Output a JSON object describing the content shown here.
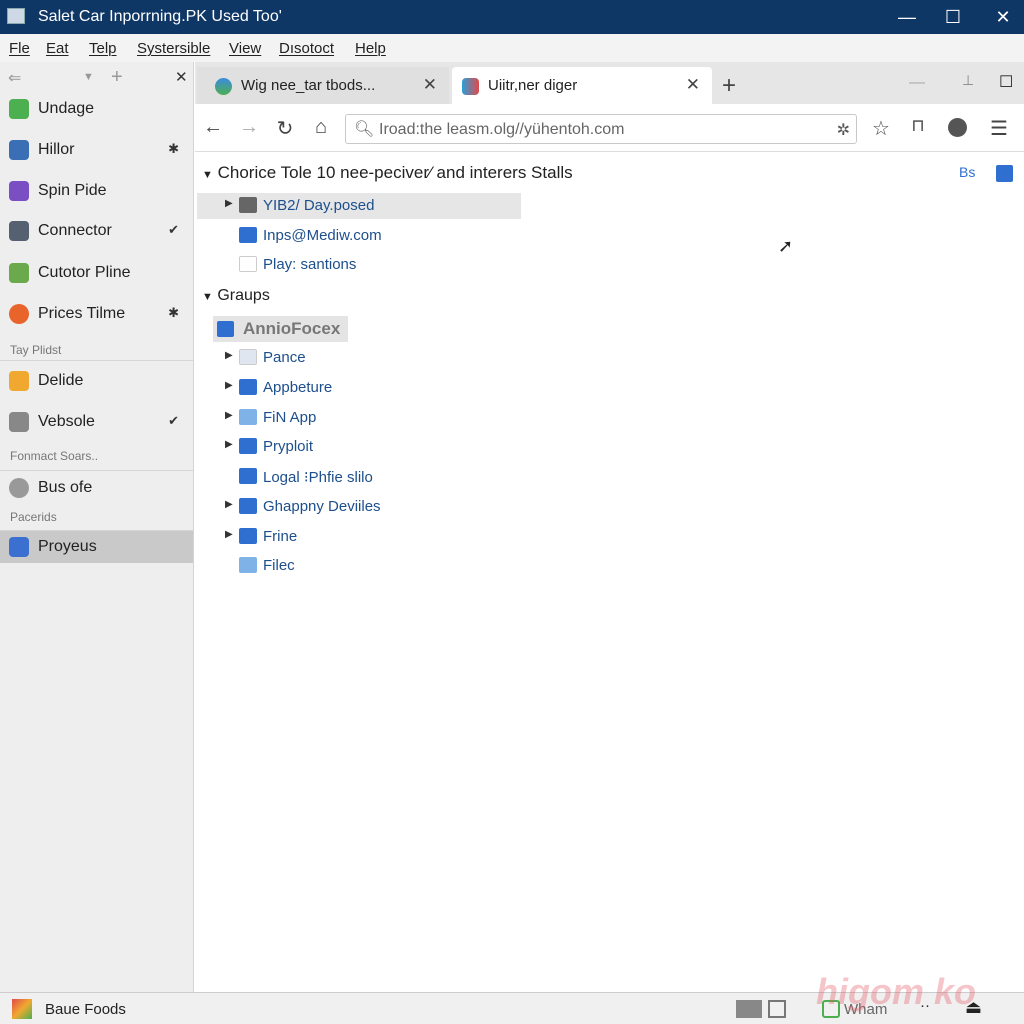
{
  "window": {
    "title": "Salet Car Inporrning.PK Used Too'",
    "controls": [
      "minimize",
      "maximize",
      "close"
    ]
  },
  "menu": [
    "Fle",
    "Eat",
    "Telp",
    "Systersible",
    "View",
    "Dısotoct",
    "Help"
  ],
  "sidebar": {
    "items": [
      {
        "label": "Undage",
        "icon": "app-icon",
        "color": "#4caf50"
      },
      {
        "label": "Hillor",
        "icon": "app-icon",
        "color": "#3a6fb5",
        "pin": "pin-icon"
      },
      {
        "label": "Spin Pide",
        "icon": "app-icon",
        "color": "#7b4fc4"
      },
      {
        "label": "Connector",
        "icon": "app-icon",
        "color": "#556070",
        "pin": "check-icon"
      },
      {
        "label": "Cutotor Pline",
        "icon": "app-icon",
        "color": "#6aaa4c"
      },
      {
        "label": "Prices Tilme",
        "icon": "firefox-icon",
        "color": "#e8642a",
        "pin": "pin-icon"
      },
      {
        "label": "Delide",
        "icon": "app-icon",
        "color": "#f0a830"
      },
      {
        "label": "Vebsole",
        "icon": "app-icon",
        "color": "#888888",
        "pin": "check-icon"
      },
      {
        "label": "Bus ofe",
        "icon": "gear-icon",
        "color": "#999999"
      },
      {
        "label": "Proyeus",
        "icon": "app-icon",
        "color": "#3b6fd0",
        "selected": true
      }
    ],
    "headers": [
      "Tay Plidst",
      "Fonmact Soars..",
      "Pacerids"
    ]
  },
  "tabs": [
    {
      "label": "Wig nee_tar tbods...",
      "active": false
    },
    {
      "label": "Uiitr,ner diger",
      "active": true
    }
  ],
  "address": {
    "url": "Iroad:the leasm.olg//yühentoh.com"
  },
  "content": {
    "section1": "Chorice Tole 10 nee-peciver⁄ and interers Stalls",
    "section1_items": [
      {
        "label": "YIB2/ Day.posed",
        "expand": true,
        "color": "#666666"
      },
      {
        "label": "Inps@Mediw.com",
        "expand": false,
        "color": "#2f6fd0"
      },
      {
        "label": "Play: santions",
        "expand": false,
        "color": "#ffffff"
      }
    ],
    "section2": "Graups",
    "selected_group": "AnnioFocex",
    "section2_items": [
      {
        "label": "Pance",
        "expand": true,
        "color": "#e0e6f0"
      },
      {
        "label": "Appbeture",
        "expand": true,
        "color": "#2f6fd0"
      },
      {
        "label": "FiN App",
        "expand": true,
        "color": "#7fb2e6"
      },
      {
        "label": "Pryploit",
        "expand": true,
        "color": "#2f6fd0"
      },
      {
        "label": "Logal ⁝Phfie slilo",
        "expand": false,
        "color": "#2f6fd0"
      },
      {
        "label": "Ghappny Deviiles",
        "expand": true,
        "color": "#2f6fd0"
      },
      {
        "label": "Frine",
        "expand": true,
        "color": "#2f6fd0"
      },
      {
        "label": "Filec",
        "expand": false,
        "color": "#7fb2e6"
      }
    ],
    "right_label": "Bs"
  },
  "statusbar": {
    "label": "Baue Foods",
    "app": "Wham",
    "watermark": "higom ko"
  }
}
